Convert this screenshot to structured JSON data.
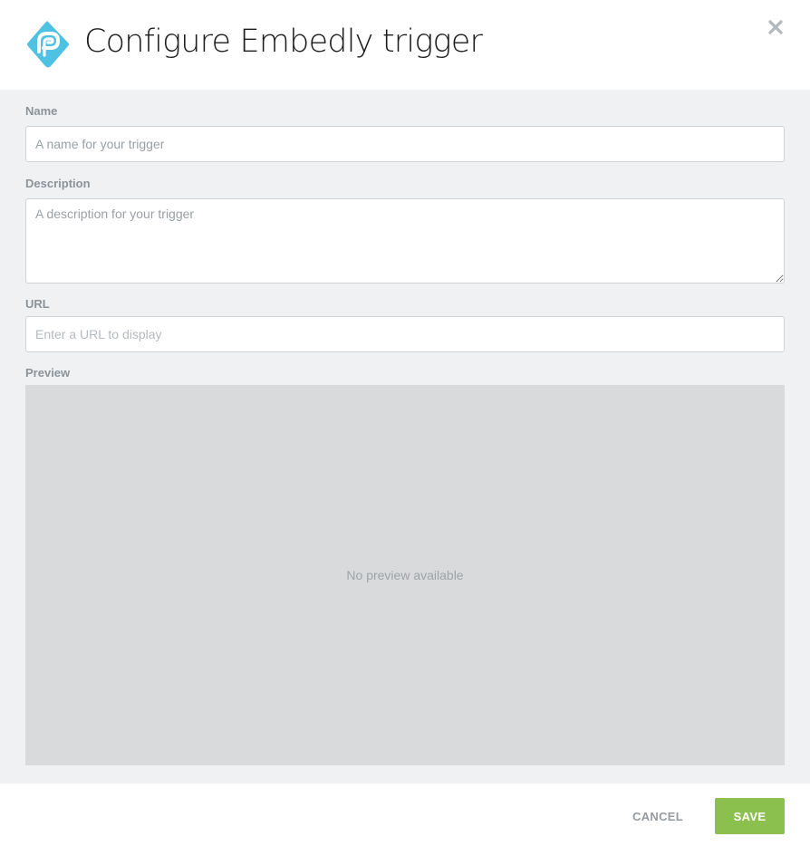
{
  "dialog": {
    "title": "Configure Embedly trigger",
    "logo_icon": "embedly-logo-icon",
    "close_icon": "close-icon"
  },
  "form": {
    "name": {
      "label": "Name",
      "placeholder": "A name for your trigger",
      "value": ""
    },
    "description": {
      "label": "Description",
      "placeholder": "A description for your trigger",
      "value": ""
    },
    "url": {
      "label": "URL",
      "placeholder": "Enter a URL to display",
      "value": ""
    },
    "preview": {
      "label": "Preview",
      "empty_text": "No preview available"
    }
  },
  "footer": {
    "cancel_label": "CANCEL",
    "save_label": "SAVE"
  },
  "colors": {
    "accent_logo": "#4fc1e3",
    "save_button": "#8bc04f",
    "body_background": "#f0f1f3",
    "preview_background": "#d9dadc"
  }
}
